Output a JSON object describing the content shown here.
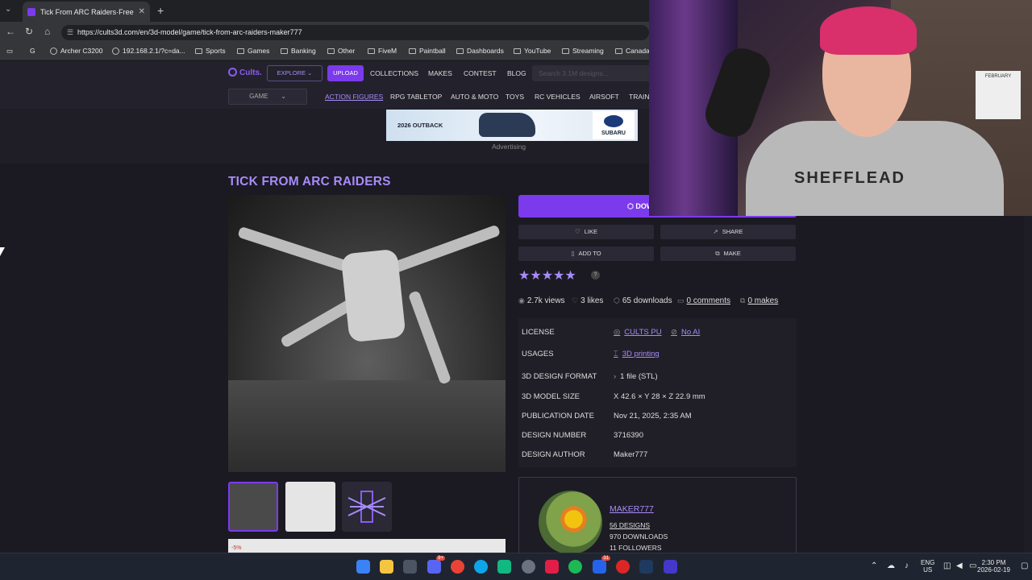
{
  "browser": {
    "tab_title": "Tick From ARC Raiders·Free ST",
    "url": "https://cults3d.com/en/3d-model/game/tick-from-arc-raiders-maker777",
    "bookmarks": [
      {
        "label": "Archer C3200",
        "icon": "router-icon"
      },
      {
        "label": "192.168.2.1/?c=da...",
        "icon": "globe-icon"
      },
      {
        "label": "Sports",
        "icon": "folder-icon"
      },
      {
        "label": "Games",
        "icon": "folder-icon"
      },
      {
        "label": "Banking",
        "icon": "folder-icon"
      },
      {
        "label": "Other",
        "icon": "folder-icon"
      },
      {
        "label": "FiveM",
        "icon": "folder-icon"
      },
      {
        "label": "Paintball",
        "icon": "folder-icon"
      },
      {
        "label": "Dashboards",
        "icon": "folder-icon"
      },
      {
        "label": "YouTube",
        "icon": "folder-icon"
      },
      {
        "label": "Streaming",
        "icon": "folder-icon"
      },
      {
        "label": "Canada",
        "icon": "folder-icon"
      }
    ]
  },
  "site": {
    "logo": "Cults.",
    "explore": "EXPLORE",
    "upload": "UPLOAD",
    "nav": [
      "COLLECTIONS",
      "MAKES",
      "CONTEST",
      "BLOG"
    ],
    "search_placeholder": "Search 3.1M designs...",
    "game_select": "GAME",
    "categories": [
      "ACTION FIGURES",
      "RPG TABLETOP",
      "AUTO & MOTO",
      "TOYS",
      "RC VEHICLES",
      "AIRSOFT",
      "TRAIN"
    ],
    "active_category": "ACTION FIGURES"
  },
  "ad": {
    "tagline": "2026 OUTBACK",
    "brand": "SUBARU",
    "label": "Advertising"
  },
  "product": {
    "title": "TICK FROM ARC RAIDERS",
    "download_label": "DOWN",
    "like": "LIKE",
    "share": "SHARE",
    "add_to": "ADD TO",
    "make": "MAKE",
    "rating": 5,
    "rating_help": "?",
    "stats": {
      "views": "2.7k views",
      "likes": "3 likes",
      "downloads": "65 downloads",
      "comments": "0 comments",
      "makes": "0 makes"
    },
    "details": [
      {
        "label": "LICENSE",
        "value": "CULTS PU",
        "extra": "No AI"
      },
      {
        "label": "USAGES",
        "value": "3D printing"
      },
      {
        "label": "3D DESIGN FORMAT",
        "value": "1 file (STL)"
      },
      {
        "label": "3D MODEL SIZE",
        "value": "X 42.6 × Y 28 × Z 22.9 mm"
      },
      {
        "label": "PUBLICATION DATE",
        "value": "Nov 21, 2025, 2:35 AM"
      },
      {
        "label": "DESIGN NUMBER",
        "value": "3716390"
      },
      {
        "label": "DESIGN AUTHOR",
        "value": "Maker777"
      }
    ]
  },
  "author": {
    "name": "MAKER777",
    "designs": "56 DESIGNS",
    "downloads": "970 DOWNLOADS",
    "followers": "11 FOLLOWERS"
  },
  "webcam": {
    "hoodie_text": "SHEFFLEAD",
    "calendar": "FEBRUARY"
  },
  "bottom_ad": {
    "badge": "-5%"
  },
  "taskbar": {
    "lang1": "ENG",
    "lang2": "US",
    "time": "2:30 PM",
    "date": "2026-02-19",
    "badge_messenger": "9+",
    "badge_store": "31"
  },
  "colors": {
    "accent": "#7c3aed",
    "link": "#a78bfa",
    "bg": "#1b1a22"
  }
}
